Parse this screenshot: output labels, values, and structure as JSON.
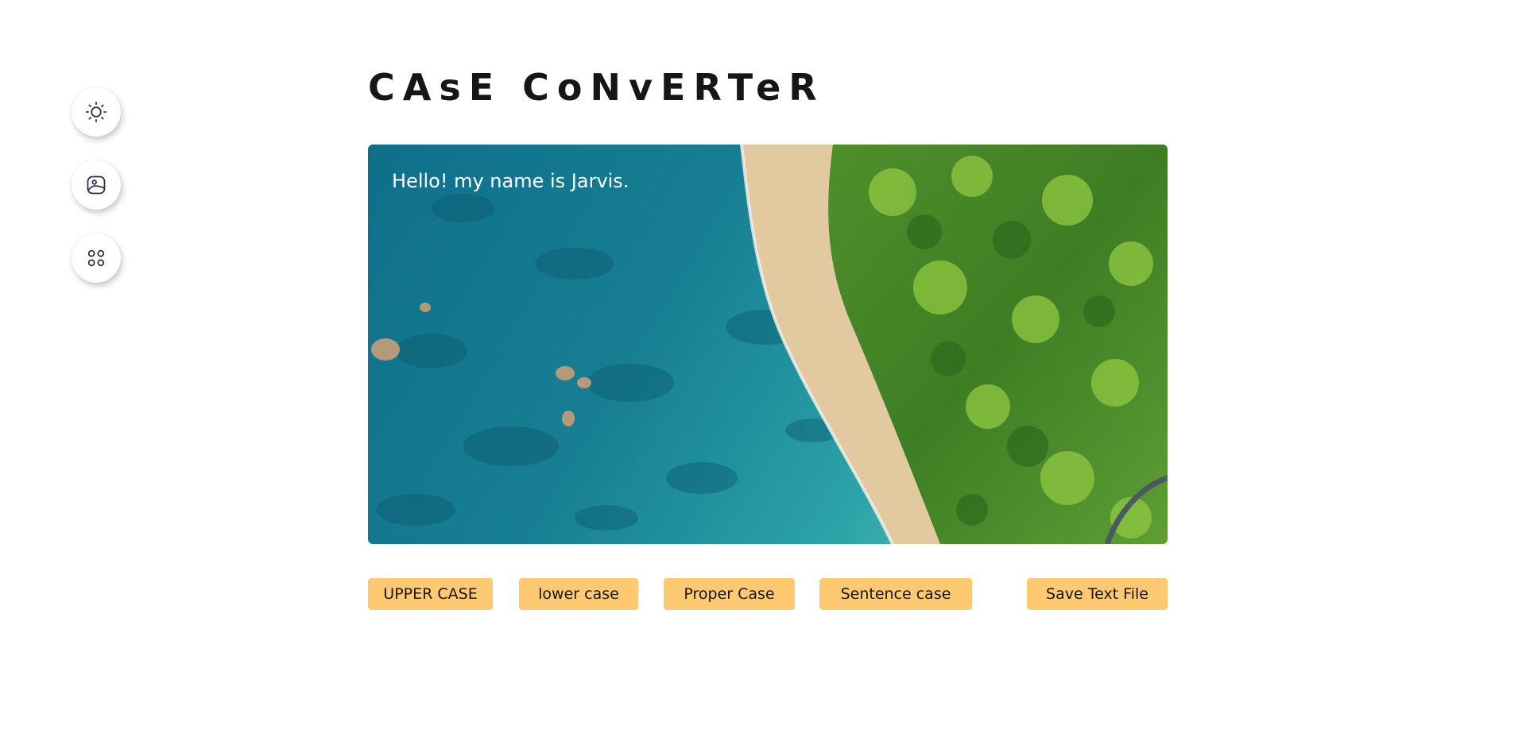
{
  "app": {
    "title": "CAsE CoNvERTeR"
  },
  "sidebar": {
    "items": [
      {
        "icon": "sun-icon",
        "label": ""
      },
      {
        "icon": "image-icon",
        "label": ""
      },
      {
        "icon": "grid-icon",
        "label": ""
      }
    ]
  },
  "editor": {
    "text": "Hello! my name is Jarvis.",
    "background": "beach-aerial-image"
  },
  "actions": {
    "upper_label": "UPPER CASE",
    "lower_label": "lower case",
    "proper_label": "Proper Case",
    "sentence_label": "Sentence case",
    "save_label": "Save Text File"
  },
  "colors": {
    "accent": "#ffc971",
    "title": "#161616",
    "icon": "#2b2b4a"
  }
}
